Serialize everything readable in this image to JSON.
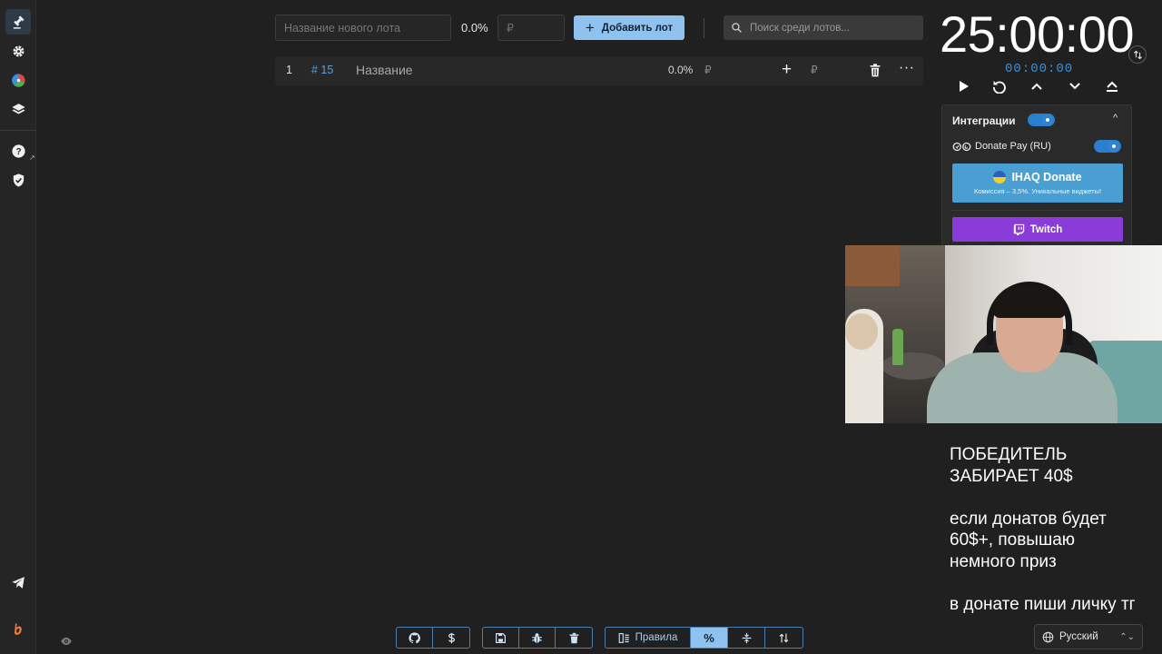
{
  "sidebar": {
    "items": [
      {
        "name": "auction-icon"
      },
      {
        "name": "settings-icon"
      },
      {
        "name": "wheel-icon"
      },
      {
        "name": "layers-icon"
      },
      {
        "name": "help-icon"
      },
      {
        "name": "shield-icon"
      },
      {
        "name": "telegram-icon"
      },
      {
        "name": "brand-logo-icon"
      }
    ],
    "external_mark": "↗"
  },
  "lot_form": {
    "name_placeholder": "Название нового лота",
    "percent": "0.0%",
    "amount_placeholder": "₽",
    "add_button": "Добавить лот",
    "add_button_icon": "+",
    "search_placeholder": "Поиск среди лотов..."
  },
  "lots": [
    {
      "index": "1",
      "id": "# 15",
      "title": "Название",
      "percent": "0.0%",
      "currency": "₽",
      "add_icon": "+",
      "currency_add": "₽",
      "more": "···"
    }
  ],
  "timer": {
    "main": "25:00:00",
    "elapsed": "00:00:00"
  },
  "integrations": {
    "title": "Интеграции",
    "chevron": "^",
    "donatepay_label": "Donate Pay (RU)",
    "ihaq_title": "IHAQ Donate",
    "ihaq_subtitle": "Комиссия – 3,5%. Уникальные виджеты!",
    "twitch_label": "Twitch",
    "colors": {
      "accent": "#2b7fcf",
      "ihaq": "#4a9fd2",
      "twitch": "#8a3bd8"
    }
  },
  "overlay": {
    "line1": "ПОБЕДИТЕЛЬ",
    "line2": "ЗАБИРАЕТ 40$",
    "line3": "если донатов будет",
    "line4": "60$+, повышаю",
    "line5": "немного приз",
    "line6": "в донате пиши личку тг"
  },
  "language": {
    "selected": "Русский",
    "caret": "⌃⌄"
  },
  "toolbar": {
    "rules_label": "Правила",
    "percent_label": "%"
  }
}
